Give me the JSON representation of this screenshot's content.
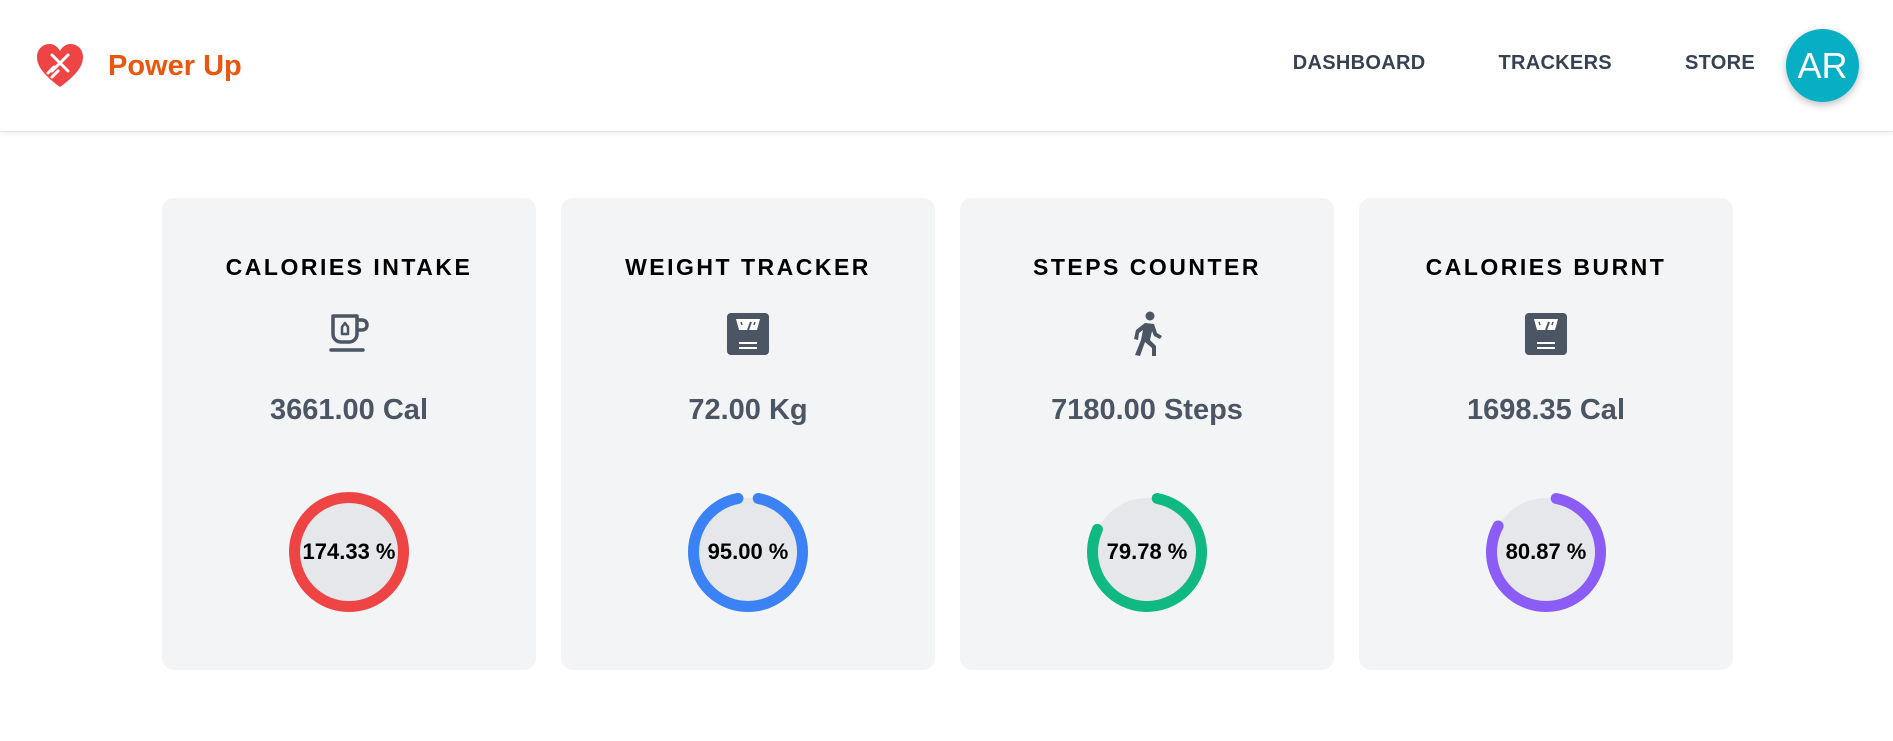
{
  "brand": {
    "name": "Power Up",
    "name_color": "#e8560f",
    "logo_color": "#ef4444",
    "logo_icon": "heart-dumbbell-icon"
  },
  "top_progress": {
    "fill_color": "#1d7fe0",
    "fill_fraction": 0.16
  },
  "nav": {
    "items": [
      {
        "label": "DASHBOARD"
      },
      {
        "label": "TRACKERS"
      },
      {
        "label": "STORE"
      }
    ]
  },
  "avatar": {
    "initials": "AR",
    "color": "#06afc4"
  },
  "cards": [
    {
      "title": "CALORIES INTAKE",
      "icon": "coffee-cup-icon",
      "value": "3661.00 Cal",
      "percent_label": "174.33 %",
      "percent": 174.33,
      "color": "#ef4444"
    },
    {
      "title": "WEIGHT TRACKER",
      "icon": "weight-scale-icon",
      "value": "72.00 Kg",
      "percent_label": "95.00 %",
      "percent": 95.0,
      "color": "#3b82f6"
    },
    {
      "title": "STEPS COUNTER",
      "icon": "walking-person-icon",
      "value": "7180.00 Steps",
      "percent_label": "79.78 %",
      "percent": 79.78,
      "color": "#10b981"
    },
    {
      "title": "CALORIES BURNT",
      "icon": "weight-scale-icon",
      "value": "1698.35 Cal",
      "percent_label": "80.87 %",
      "percent": 80.87,
      "color": "#8b5cf6"
    }
  ],
  "ring_track_color": "#e5e7eb"
}
